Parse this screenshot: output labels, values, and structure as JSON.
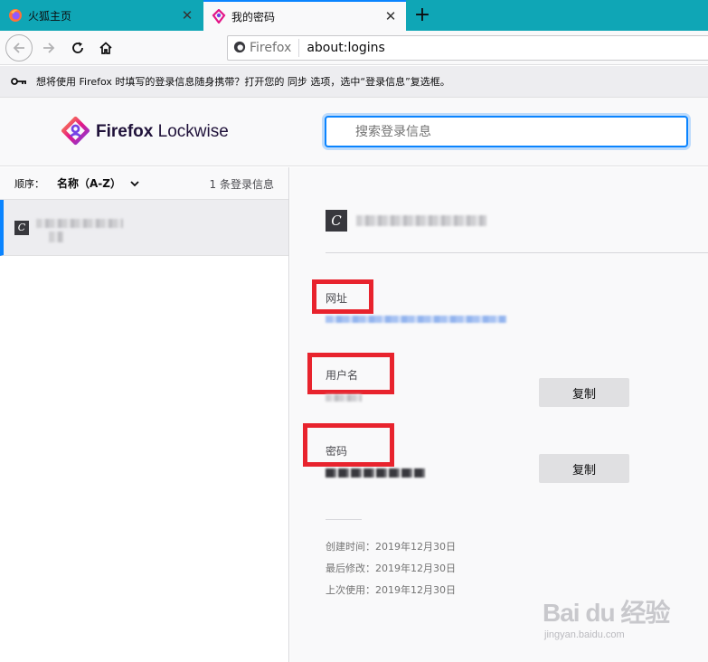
{
  "tabs": [
    {
      "label": "火狐主页",
      "active": false
    },
    {
      "label": "我的密码",
      "active": true
    }
  ],
  "navbar": {
    "identity_label": "Firefox",
    "url": "about:logins"
  },
  "notification": {
    "text": "想将使用 Firefox 时填写的登录信息随身携带？打开您的 同步 选项，选中“登录信息”复选框。"
  },
  "header": {
    "brand_bold": "Firefox",
    "brand_light": " Lockwise",
    "search_placeholder": "搜索登录信息"
  },
  "list": {
    "sort_label": "顺序：",
    "sort_value": "名称（A-Z）",
    "count": "1 条登录信息",
    "items": [
      {
        "favicon_letter": "C"
      }
    ]
  },
  "detail": {
    "favicon_letter": "C",
    "url_label": "网址",
    "username_label": "用户名",
    "password_label": "密码",
    "copy_username": "复制",
    "copy_password": "复制",
    "created": "创建时间：2019年12月30日",
    "modified": "最后修改：2019年12月30日",
    "last_used": "上次使用：2019年12月30日"
  },
  "watermark": {
    "main": "Bai du 经验",
    "sub": "jingyan.baidu.com"
  },
  "colors": {
    "tab_strip": "#0fa6b6",
    "accent": "#0a84ff",
    "highlight_box": "#e8232d"
  }
}
